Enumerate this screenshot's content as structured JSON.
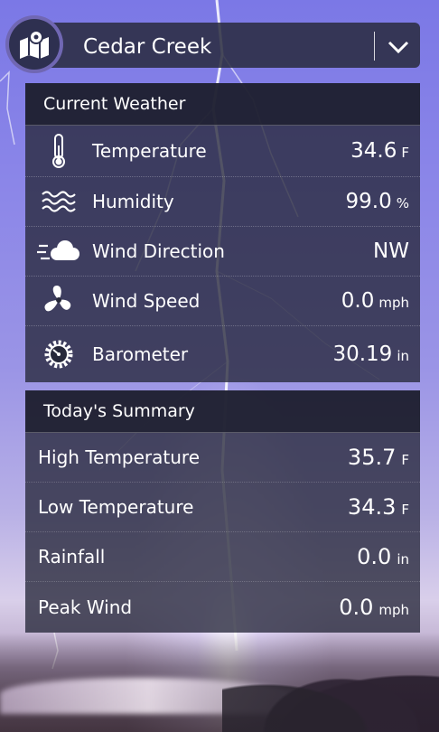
{
  "header": {
    "location": "Cedar Creek",
    "logo_icon": "map-pin-icon",
    "dropdown_icon": "chevron-down-icon"
  },
  "current": {
    "heading": "Current Weather",
    "rows": [
      {
        "label": "Temperature",
        "value": "34.6",
        "unit": "F",
        "icon": "thermometer-icon"
      },
      {
        "label": "Humidity",
        "value": "99.0",
        "unit": "%",
        "icon": "humidity-waves-icon"
      },
      {
        "label": "Wind Direction",
        "value": "NW",
        "unit": "",
        "icon": "wind-cloud-icon"
      },
      {
        "label": "Wind Speed",
        "value": "0.0",
        "unit": "mph",
        "icon": "fan-icon"
      },
      {
        "label": "Barometer",
        "value": "30.19",
        "unit": "in",
        "icon": "gauge-icon"
      }
    ]
  },
  "summary": {
    "heading": "Today's Summary",
    "rows": [
      {
        "label": "High Temperature",
        "value": "35.7",
        "unit": "F"
      },
      {
        "label": "Low Temperature",
        "value": "34.3",
        "unit": "F"
      },
      {
        "label": "Rainfall",
        "value": "0.0",
        "unit": "in"
      },
      {
        "label": "Peak Wind",
        "value": "0.0",
        "unit": "mph"
      }
    ]
  },
  "colors": {
    "panel": "#26283a",
    "accent": "#7a70c0",
    "text": "#ffffff"
  }
}
